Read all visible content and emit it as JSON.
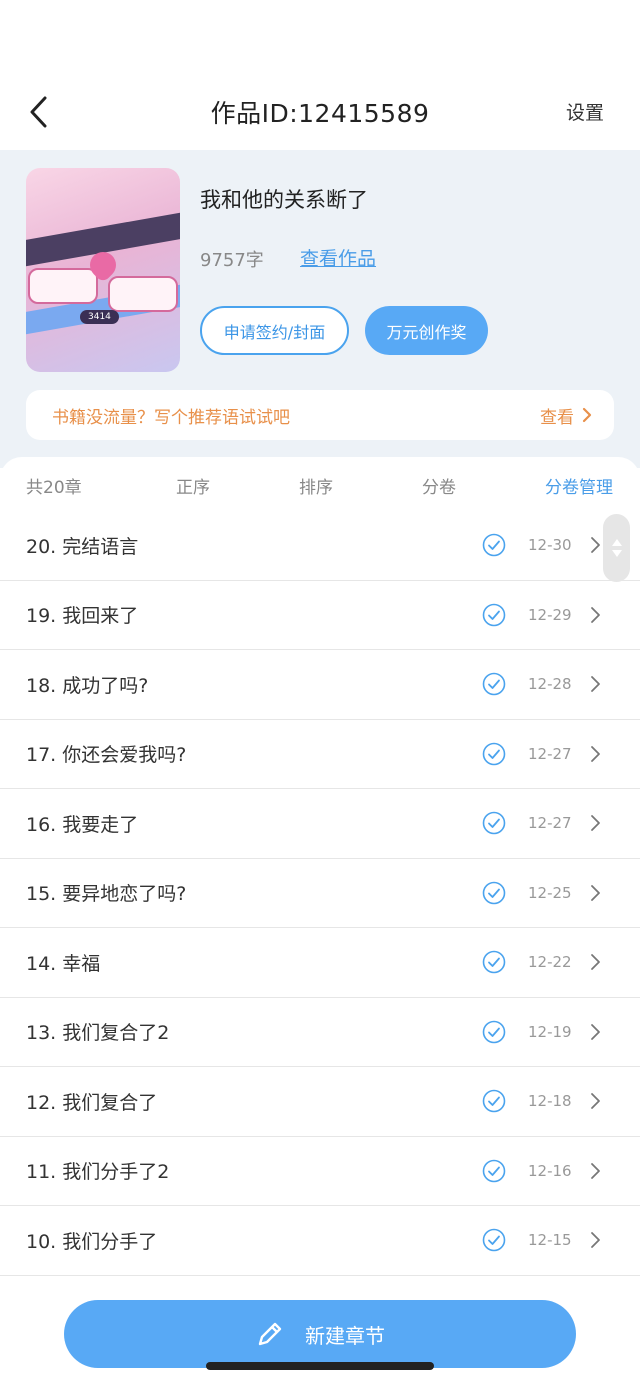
{
  "navbar": {
    "title": "作品ID:12415589",
    "settings_label": "设置"
  },
  "work": {
    "title": "我和他的关系断了",
    "word_count": "9757字",
    "view_link": "查看作品",
    "sign_button": "申请签约/封面",
    "award_button": "万元创作奖",
    "cover_number": "3414"
  },
  "promo": {
    "text": "书籍没流量？写个推荐语试试吧",
    "action": "查看"
  },
  "tabs": {
    "count": "共20章",
    "order": "正序",
    "sort": "排序",
    "volume": "分卷",
    "manage": "分卷管理"
  },
  "chapters": [
    {
      "title": "20. 完结语言",
      "date": "12-30"
    },
    {
      "title": "19. 我回来了",
      "date": "12-29"
    },
    {
      "title": "18. 成功了吗?",
      "date": "12-28"
    },
    {
      "title": "17. 你还会爱我吗?",
      "date": "12-27"
    },
    {
      "title": "16. 我要走了",
      "date": "12-27"
    },
    {
      "title": "15. 要异地恋了吗?",
      "date": "12-25"
    },
    {
      "title": "14. 幸福",
      "date": "12-22"
    },
    {
      "title": "13. 我们复合了2",
      "date": "12-19"
    },
    {
      "title": "12. 我们复合了",
      "date": "12-18"
    },
    {
      "title": "11. 我们分手了2",
      "date": "12-16"
    },
    {
      "title": "10. 我们分手了",
      "date": "12-15"
    }
  ],
  "new_chapter_label": "新建章节",
  "colors": {
    "accent": "#58a9f5",
    "link": "#4a9de8",
    "promo": "#e8904a",
    "header_bg": "#edf2f7"
  },
  "icons": {
    "back": "chevron-left-icon",
    "check": "check-circle-icon",
    "row_arrow": "chevron-right-icon",
    "pencil": "pencil-icon"
  }
}
